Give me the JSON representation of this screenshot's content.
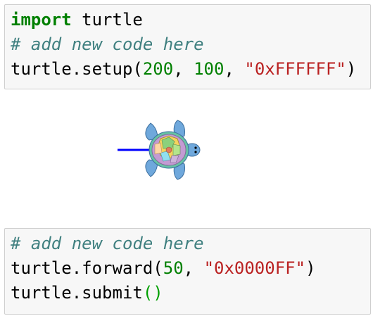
{
  "cell1": {
    "line1": {
      "keyword": "import",
      "rest": " turtle"
    },
    "line2": {
      "comment": "# add new code here"
    },
    "line3": {
      "prefix": "turtle.setup(",
      "arg1": "200",
      "sep1": ", ",
      "arg2": "100",
      "sep2": ", ",
      "arg3": "\"0xFFFFFF\"",
      "suffix": ")"
    }
  },
  "output": {
    "canvas_color": "#FFFFFF",
    "line_color": "#0000FF",
    "line_length": 50,
    "turtle_icon": "turtle-icon"
  },
  "cell2": {
    "line1": {
      "comment": "# add new code here"
    },
    "line2": {
      "prefix": "turtle.forward(",
      "arg1": "50",
      "sep1": ", ",
      "arg2": "\"0x0000FF\"",
      "suffix": ")"
    },
    "line3": {
      "prefix": "turtle.submit",
      "parens": "()"
    }
  }
}
